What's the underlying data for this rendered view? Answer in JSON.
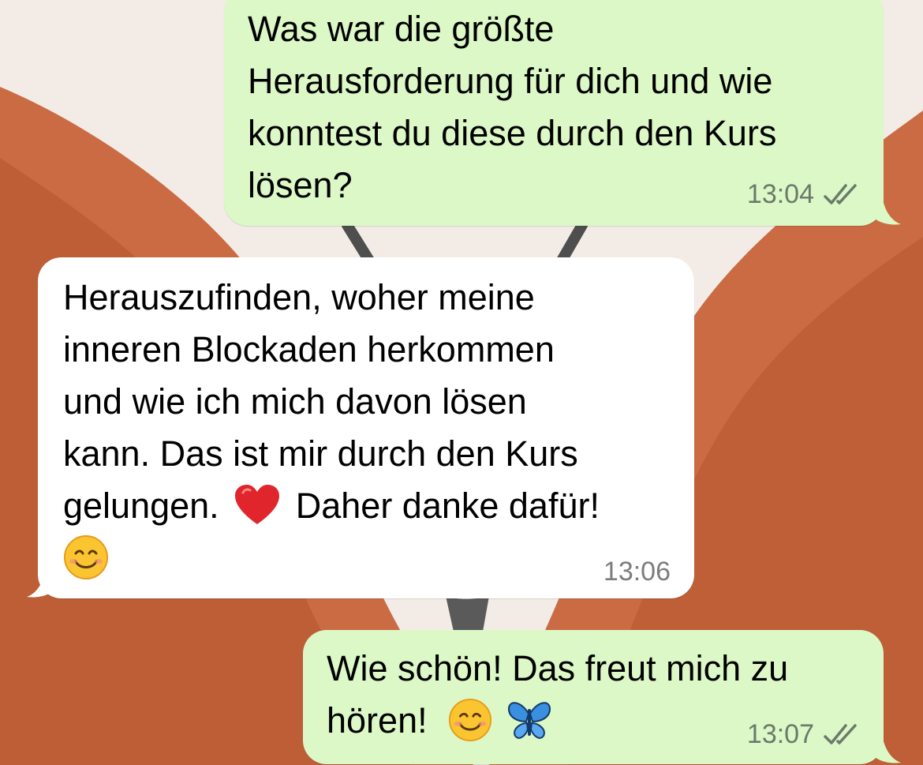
{
  "wallpaper": {
    "colors": {
      "background": "#f3ece6",
      "petal": "#c8643a",
      "petal_dark": "#b4532e",
      "body": "#5a5a5a"
    }
  },
  "colors": {
    "outgoing_bubble": "#dcf8c6",
    "incoming_bubble": "#ffffff",
    "read_ticks": "#6b7a6b"
  },
  "messages": [
    {
      "direction": "outgoing",
      "lines": [
        "Was war die größte",
        "Herausforderung für dich und wie",
        "konntest du diese durch den Kurs",
        "lösen?"
      ],
      "time": "13:04",
      "status_icon": "double-check-icon"
    },
    {
      "direction": "incoming",
      "lines": [
        "Herauszufinden, woher meine",
        "inneren Blockaden herkommen",
        "und wie ich mich davon lösen",
        "kann. Das ist mir durch den Kurs"
      ],
      "line5_before": "gelungen.",
      "line5_emoji": "red-heart-emoji",
      "line5_after": "Daher danke dafür!",
      "line6_emoji": "smiling-face-emoji",
      "time": "13:06"
    },
    {
      "direction": "outgoing",
      "line1": "Wie schön! Das freut mich zu",
      "line2": "hören!",
      "line2_emojis": [
        "smiling-face-emoji",
        "butterfly-emoji"
      ],
      "time": "13:07",
      "status_icon": "double-check-icon"
    }
  ]
}
